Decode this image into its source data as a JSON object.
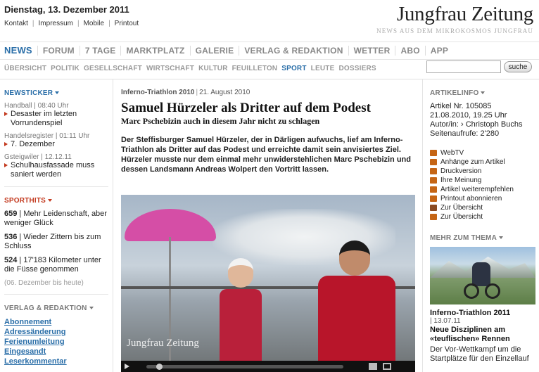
{
  "header": {
    "date": "Dienstag, 13. Dezember 2011",
    "links": [
      "Kontakt",
      "Impressum",
      "Mobile",
      "Printout"
    ],
    "brand": "Jungfrau Zeitung",
    "tagline": "NEWS AUS DEM MIKROKOSMOS JUNGFRAU"
  },
  "mainnav": [
    "NEWS",
    "FORUM",
    "7 TAGE",
    "MARKTPLATZ",
    "GALERIE",
    "VERLAG & REDAKTION",
    "WETTER",
    "ABO",
    "APP"
  ],
  "subnav": [
    "ÜBERSICHT",
    "POLITIK",
    "GESELLSCHAFT",
    "WIRTSCHAFT",
    "KULTUR",
    "FEUILLETON",
    "SPORT",
    "LEUTE",
    "DOSSIERS"
  ],
  "search": {
    "placeholder": "",
    "button": "suche"
  },
  "newsticker": {
    "title": "NEWSTICKER",
    "entries": [
      {
        "meta": "Handball | 08:40 Uhr",
        "title": "Desaster im letzten Vorrundenspiel"
      },
      {
        "meta": "Handelsregister | 01:11 Uhr",
        "title": "7. Dezember"
      },
      {
        "meta": "Gsteigwiler | 12.12.11",
        "title": "Schulhausfassade muss saniert werden"
      }
    ]
  },
  "sporthits": {
    "title": "SPORTHITS",
    "entries": [
      {
        "num": "659",
        "text": " | Mehr Leidenschaft, aber weniger Glück"
      },
      {
        "num": "536",
        "text": " | Wieder Zittern bis zum Schluss"
      },
      {
        "num": "524",
        "text": " | 17'183 Kilometer unter die Füsse genommen"
      }
    ],
    "note": "(06. Dezember bis heute)"
  },
  "verlag": {
    "title": "VERLAG & REDAKTION",
    "links": [
      "Abonnement",
      "Adressänderung",
      "Ferienumleitung",
      "Eingesandt",
      "Leserkommentar"
    ]
  },
  "article": {
    "category": "Inferno-Triathlon 2010",
    "date": "21. August 2010",
    "headline": "Samuel Hürzeler als Dritter auf dem Podest",
    "subhead": "Marc Pschebizin auch in diesem Jahr nicht zu schlagen",
    "lead": "Der Steffisburger Samuel Hürzeler, der in Därligen aufwuchs, lief am Inferno-Triathlon als Dritter auf das Podest und erreichte damit sein anvisiertes Ziel. Hürzeler musste nur dem einmal mehr unwiderstehlichen Marc Pschebizin und dessen Landsmann Andreas Wolpert den Vortritt lassen.",
    "video_watermark": "Jungfrau Zeitung",
    "video_progress": 0.05
  },
  "artikelinfo": {
    "title": "ARTIKELINFO",
    "lines": [
      "Artikel Nr. 105085",
      "21.08.2010, 19.25 Uhr",
      "Autor/in: › Christoph Buchs",
      "Seitenaufrufe: 2'280"
    ],
    "tools": [
      "WebTV",
      "Anhänge zum Artikel",
      "Druckversion",
      "Ihre Meinung",
      "Artikel weiterempfehlen",
      "Printout abonnieren",
      "Zur Übersicht",
      "Zur Übersicht"
    ]
  },
  "mehrzumthema": {
    "title": "MEHR ZUM THEMA",
    "item_title": "Inferno-Triathlon 2011",
    "item_date": "13.07.11",
    "item_head": "Neue Disziplinen am «teuflischen» Rennen",
    "item_text": "Der Vor-Wettkampf um die Startplätze für den Einzellauf"
  }
}
